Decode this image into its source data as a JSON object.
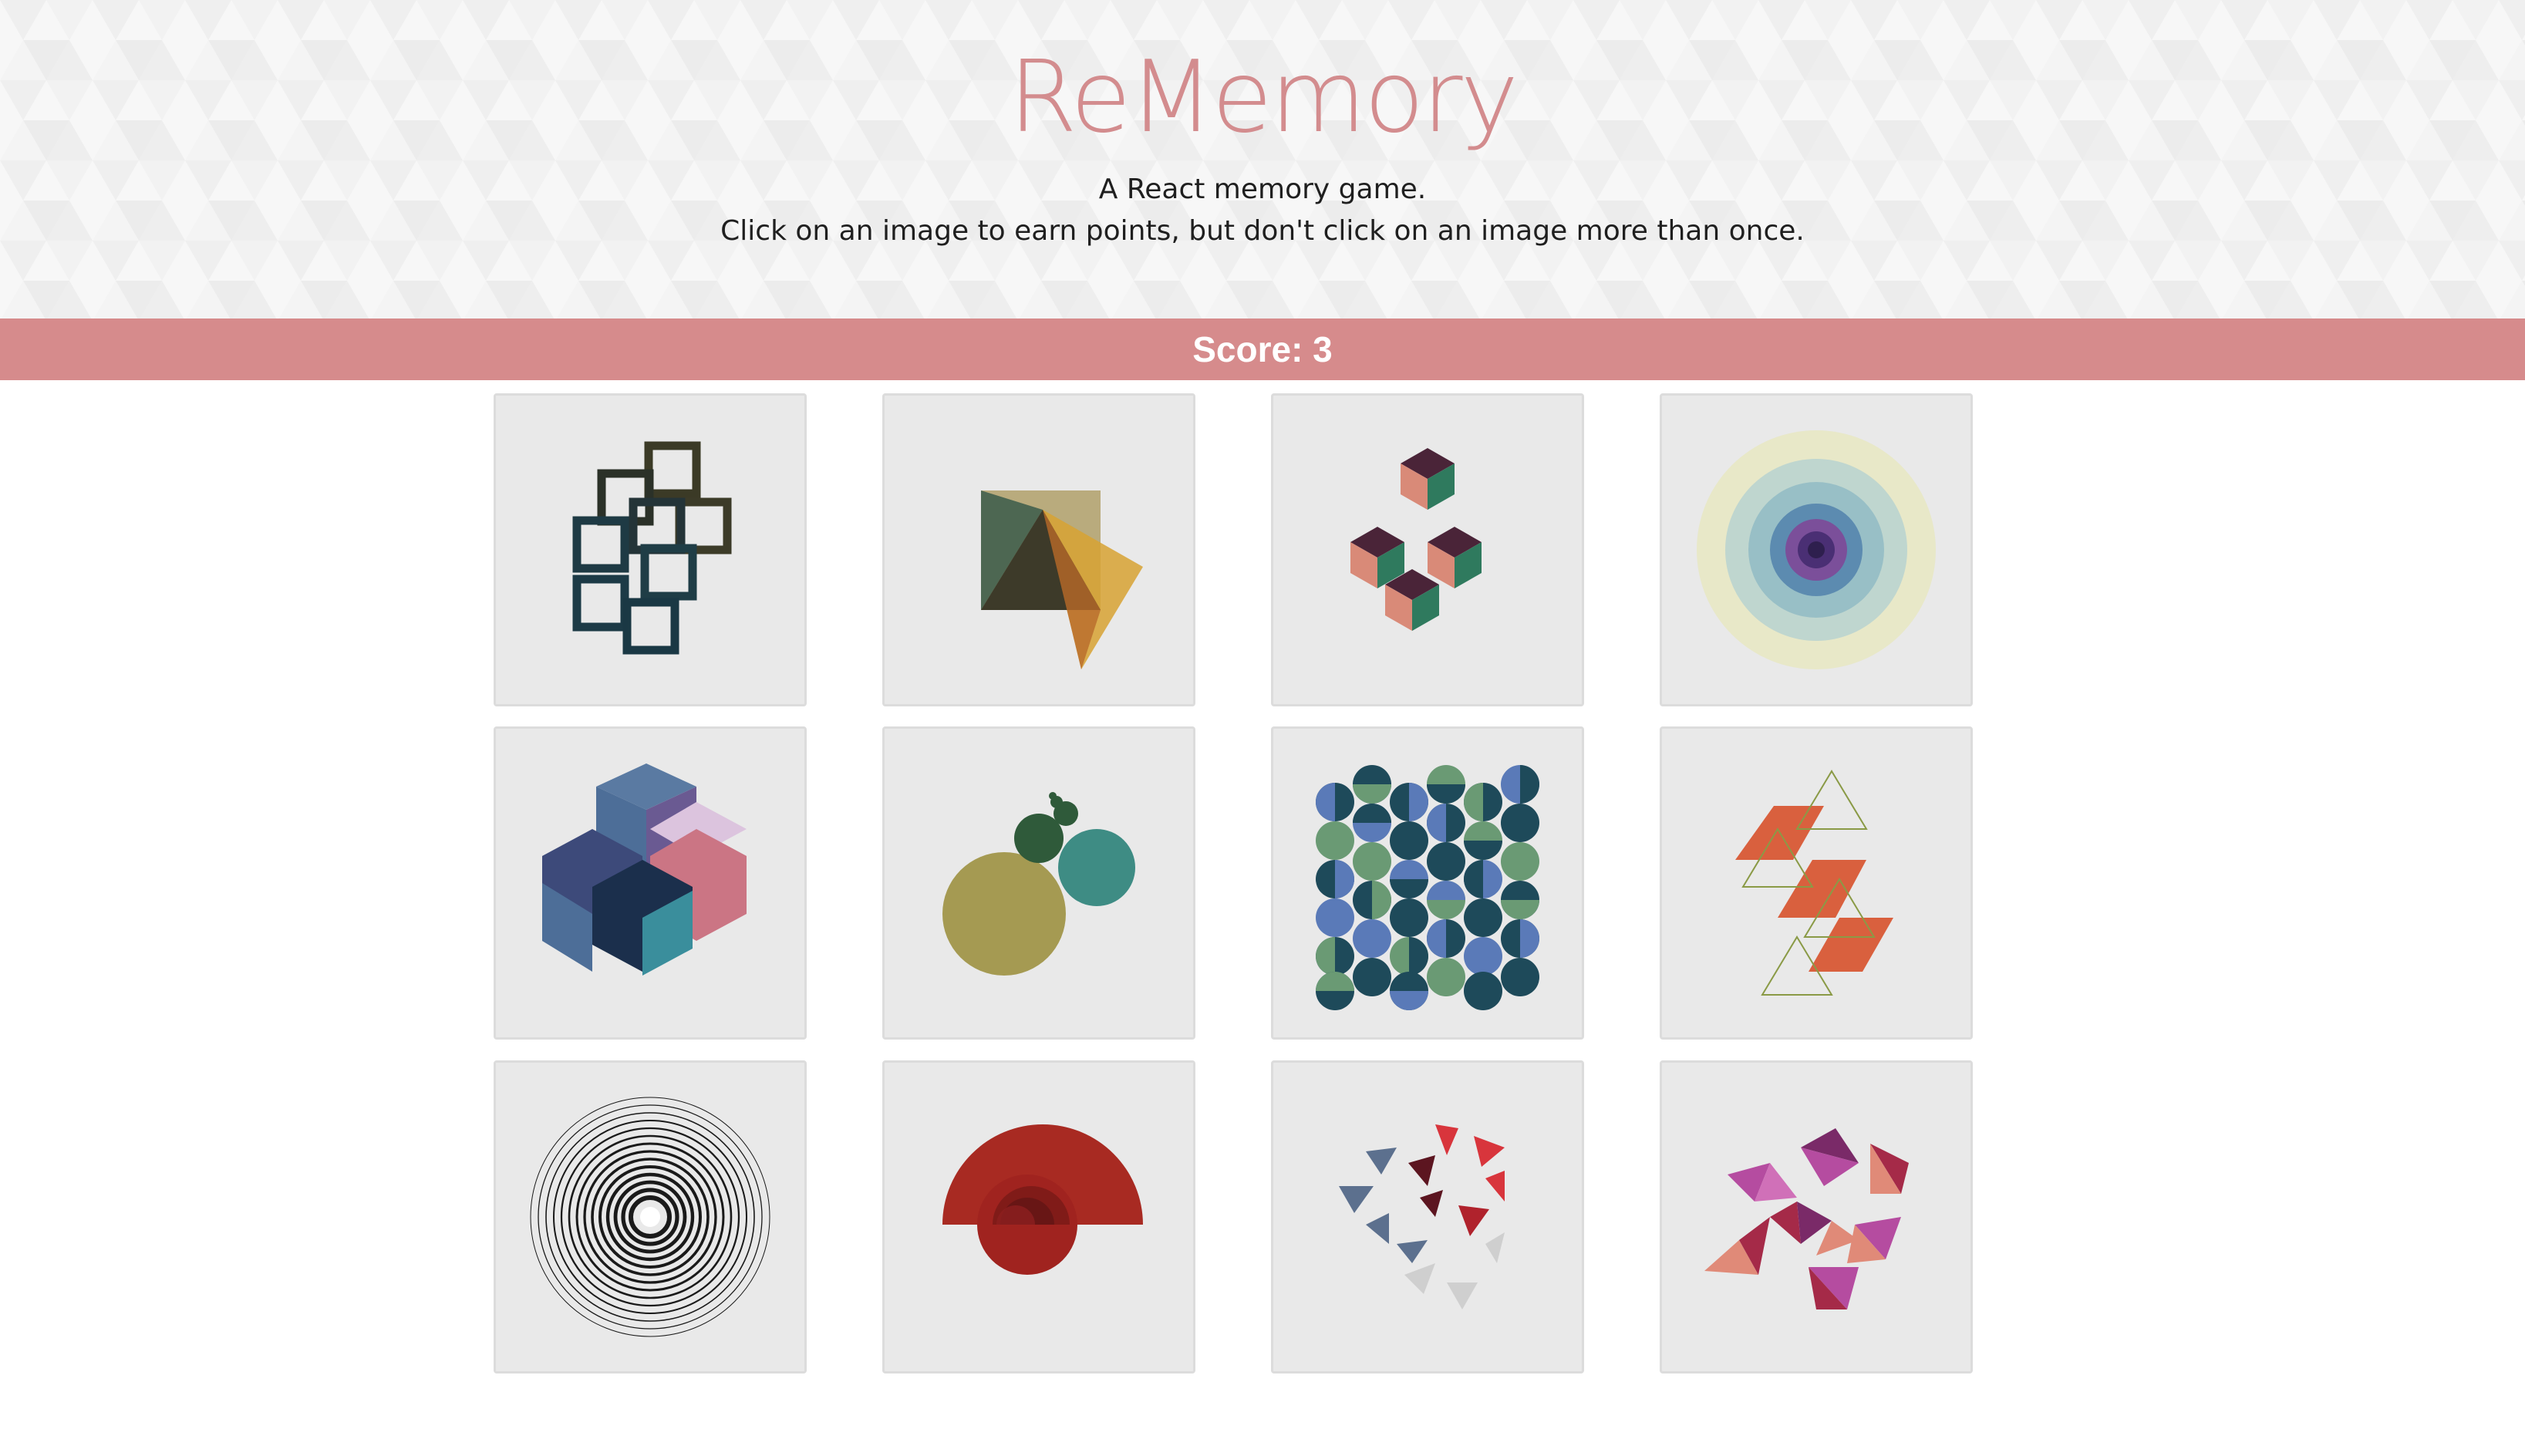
{
  "header": {
    "title": "ReMemory",
    "subtitle_line1": "A React memory game.",
    "subtitle_line2": "Click on an image to earn points, but don't click on an image more than once."
  },
  "score": {
    "label": "Score: 3",
    "value": 3
  },
  "colors": {
    "accent": "#d68b8c",
    "title": "#d38c8e",
    "card_background": "#e9e9e9",
    "header_background": "#f7f7f7"
  },
  "cards": [
    {
      "name": "overlapping-squares-art",
      "icon": "squares-chain-icon"
    },
    {
      "name": "triangle-square-overlay-art",
      "icon": "triangles-icon"
    },
    {
      "name": "isometric-cubes-art",
      "icon": "cubes-icon"
    },
    {
      "name": "concentric-circles-color-art",
      "icon": "target-icon"
    },
    {
      "name": "hexagon-cubes-art",
      "icon": "hexagon-icon"
    },
    {
      "name": "circle-cluster-art",
      "icon": "circles-icon"
    },
    {
      "name": "circle-grid-pattern-art",
      "icon": "dots-grid-icon"
    },
    {
      "name": "parallelogram-triangles-art",
      "icon": "zigzag-icon"
    },
    {
      "name": "spiral-rings-art",
      "icon": "spiral-icon"
    },
    {
      "name": "red-semicircle-art",
      "icon": "fan-icon"
    },
    {
      "name": "scattered-triangles-art",
      "icon": "triangles-scatter-icon"
    },
    {
      "name": "pink-tetrahedra-art",
      "icon": "polyhedra-icon"
    }
  ]
}
